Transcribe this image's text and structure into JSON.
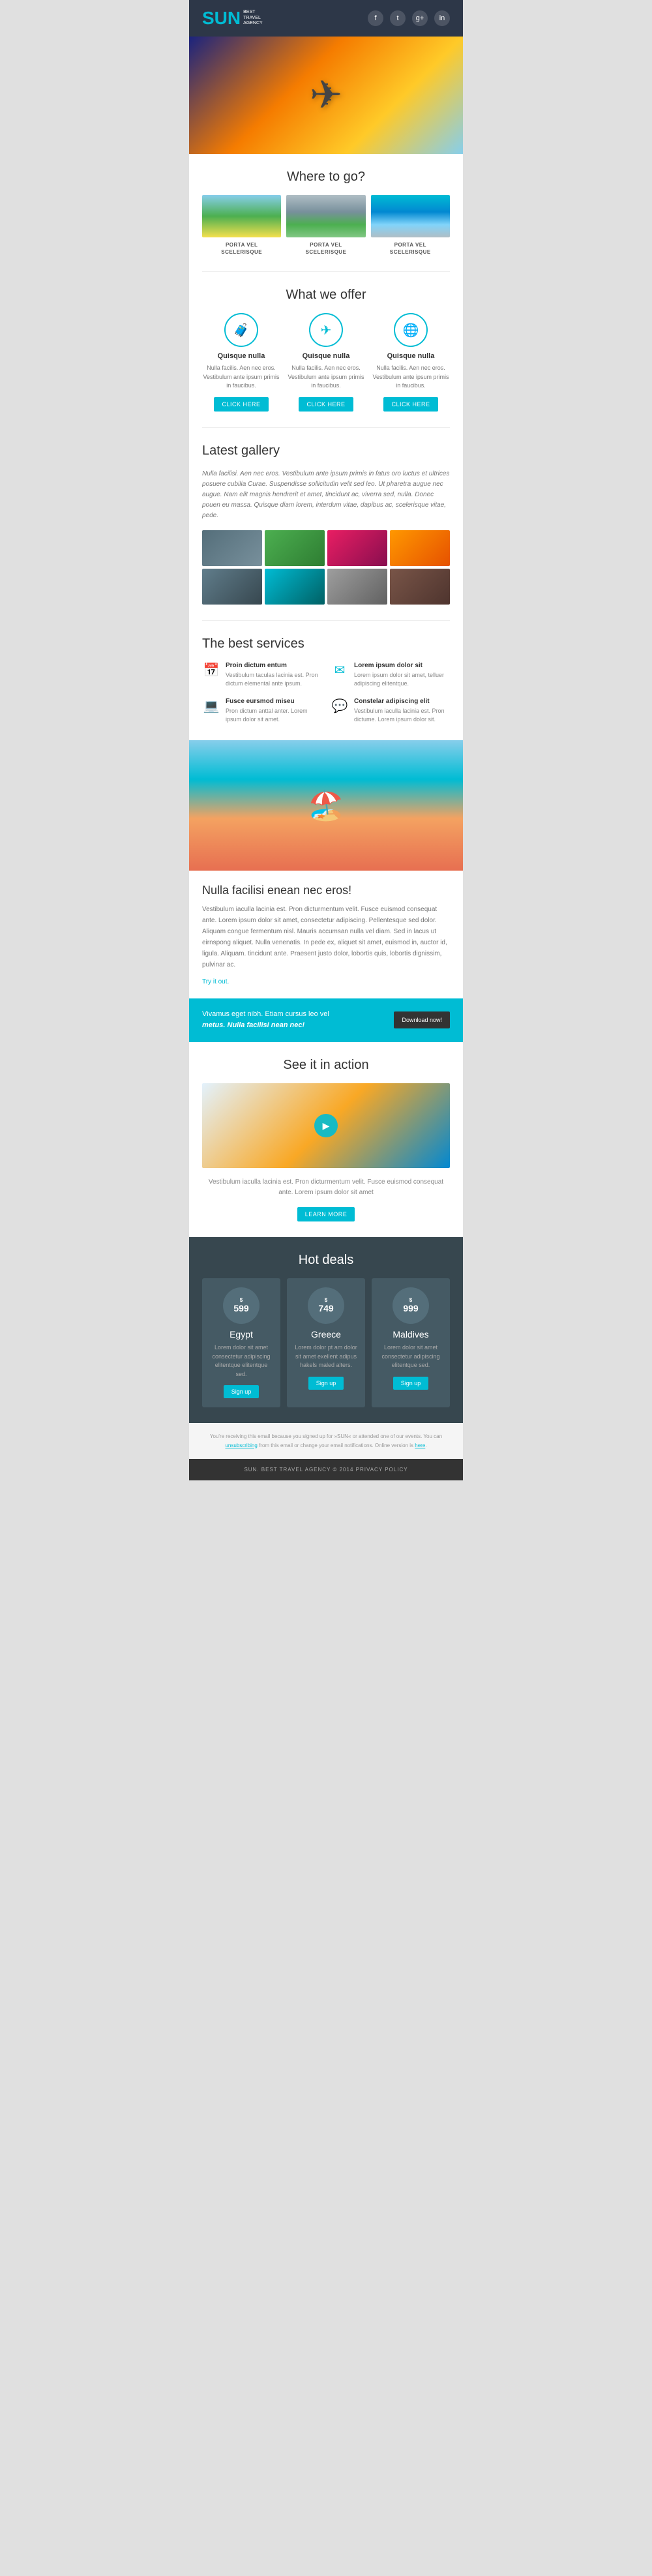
{
  "header": {
    "logo": "SUN",
    "tagline": "BEST\nTRAVEL\nAGENCY",
    "social": [
      "f",
      "t",
      "g+",
      "in"
    ]
  },
  "where_to_go": {
    "title": "Where to go?",
    "destinations": [
      {
        "label": "PORTA VEL\nSCELERISQUE",
        "color_class": "dest-img-beach"
      },
      {
        "label": "PORTA VEL\nSCELERISQUE",
        "color_class": "dest-img-eiffel"
      },
      {
        "label": "PORTA VEL\nSCELERISQUE",
        "color_class": "dest-img-water"
      }
    ]
  },
  "what_we_offer": {
    "title": "What we offer",
    "items": [
      {
        "icon": "🧳",
        "title": "Quisque nulla",
        "text": "Nulla facilis. Aen nec eros. Vestibulum ante ipsum primis in faucibus.",
        "button": "Click here"
      },
      {
        "icon": "✈",
        "title": "Quisque nulla",
        "text": "Nulla facilis. Aen nec eros. Vestibulum ante ipsum primis in faucibus.",
        "button": "Click here"
      },
      {
        "icon": "🌐",
        "title": "Quisque nulla",
        "text": "Nulla facilis. Aen nec eros. Vestibulum ante ipsum primis in faucibus.",
        "button": "Click here"
      }
    ]
  },
  "latest_gallery": {
    "title": "Latest gallery",
    "intro": "Nulla facilisi. Aen nec eros. Vestibulum ante ipsum primis in fatus oro luctus et ultrices posuere cubilia Curae. Suspendisse sollicitudin velit sed leo. Ut pharetra augue nec augue. Nam elit magnis hendrerit et amet, tincidunt ac, viverra sed, nulla. Donec pouen eu massa. Quisque diam lorem, interdum vitae, dapibus ac, scelerisque vitae, pede.",
    "thumbs": [
      "g1",
      "g2",
      "g3",
      "g4",
      "g5",
      "g6",
      "g7",
      "g8"
    ]
  },
  "best_services": {
    "title": "The best services",
    "items": [
      {
        "icon": "📅",
        "title": "Proin dictum entum",
        "text": "Vestibulum taculas lacinia est. Pron dictum elemental ante ipsum."
      },
      {
        "icon": "✉",
        "title": "Lorem ipsum dolor sit",
        "text": "Lorem ipsum dolor sit amet, telluer adipiscing elitentque."
      },
      {
        "icon": "💻",
        "title": "Fusce eursmod miseu",
        "text": "Pron dictum anttal anter. Lorem ipsum dolor sit amet."
      },
      {
        "icon": "💬",
        "title": "Constelar adipiscing elit",
        "text": "Vestibulum iaculla lacinia est. Pron dictume. Lorem ipsum dolor sit."
      }
    ]
  },
  "nulla_section": {
    "title": "Nulla facilisi enean nec eros!",
    "text": "Vestibulum iaculla lacinia est. Pron dicturmentum velit. Fusce euismod consequat ante. Lorem ipsum dolor sit amet, consectetur adipiscing. Pellentesque sed dolor. Aliquam congue fermentum nisl. Mauris accumsan nulla vel diam. Sed in lacus ut eirnspong aliquet. Nulla venenatis. In pede ex, aliquet sit amet, euismod in, auctor id, ligula. Aliquam. tincidunt ante. Praesent justo dolor, lobortis quis, lobortis dignissim, pulvinar ac.",
    "try_link": "Try it out."
  },
  "cta_banner": {
    "text_line1": "Vivamus eget nibh. Etiam cursus leo vel",
    "text_line2": "metus. Nulla facilisi nean nec!",
    "button": "Download now!"
  },
  "see_in_action": {
    "title": "See it in action",
    "caption": "Vestibulum iaculla lacinia est. Pron dicturmentum velit. Fusce euismod\nconsequat ante. Lorem ipsum dolor sit amet",
    "button": "Learn more"
  },
  "hot_deals": {
    "title": "Hot deals",
    "deals": [
      {
        "price": "$599",
        "price_num": "599",
        "destination": "Egypt",
        "text": "Lorem dolor sit amet consectetur adipiscing elitentque elitentque sed.",
        "button": "Sign up"
      },
      {
        "price": "$749",
        "price_num": "749",
        "destination": "Greece",
        "text": "Lorem dolor pt am dolor sit amet exellent adipus hakels maled alters.",
        "button": "Sign up"
      },
      {
        "price": "$999",
        "price_num": "999",
        "destination": "Maldives",
        "text": "Lorem dolor sit amet consectetur adipiscing elitentque sed.",
        "button": "Sign up"
      }
    ]
  },
  "footer": {
    "notice": "You're receiving this email because you signed up for »SUN« or attended one of our events. You can unsubscribe from this email or change your email notifications. Online version is here.",
    "copyright": "SUN. BEST TRAVEL AGENCY © 2014 PRIVACY POLICY"
  }
}
